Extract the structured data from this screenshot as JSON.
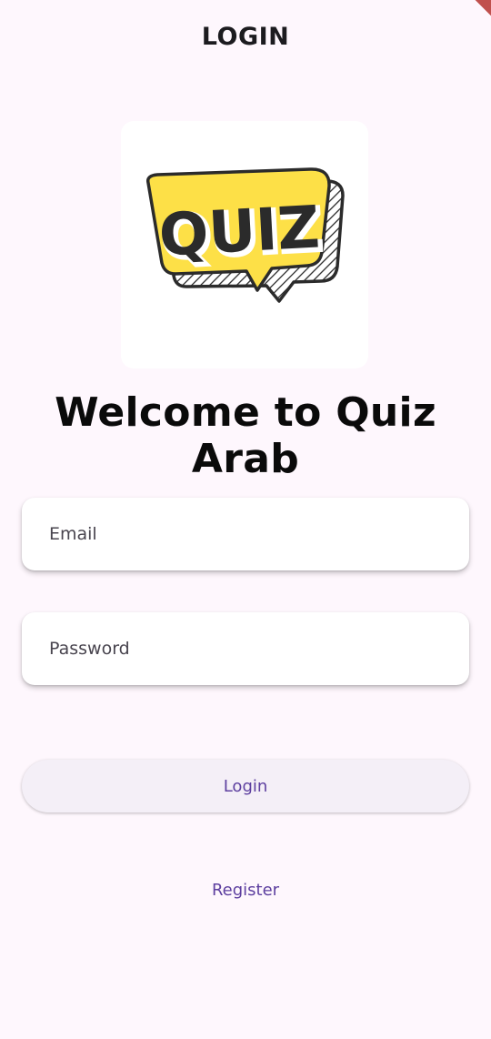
{
  "app_bar": {
    "title": "LOGIN"
  },
  "logo": {
    "text": "QUIZ",
    "icon": "quiz-speech-bubble-logo",
    "fill_color": "#fde047",
    "outline_color": "#2b2b2b"
  },
  "welcome": {
    "heading": "Welcome to Quiz Arab"
  },
  "form": {
    "email_placeholder": "Email",
    "email_value": "",
    "password_placeholder": "Password",
    "password_value": ""
  },
  "actions": {
    "login_label": "Login",
    "register_label": "Register"
  },
  "colors": {
    "background": "#fef7fd",
    "accent": "#5e40a0",
    "button_bg": "#f4eff7",
    "debug_banner": "#c0504d"
  }
}
